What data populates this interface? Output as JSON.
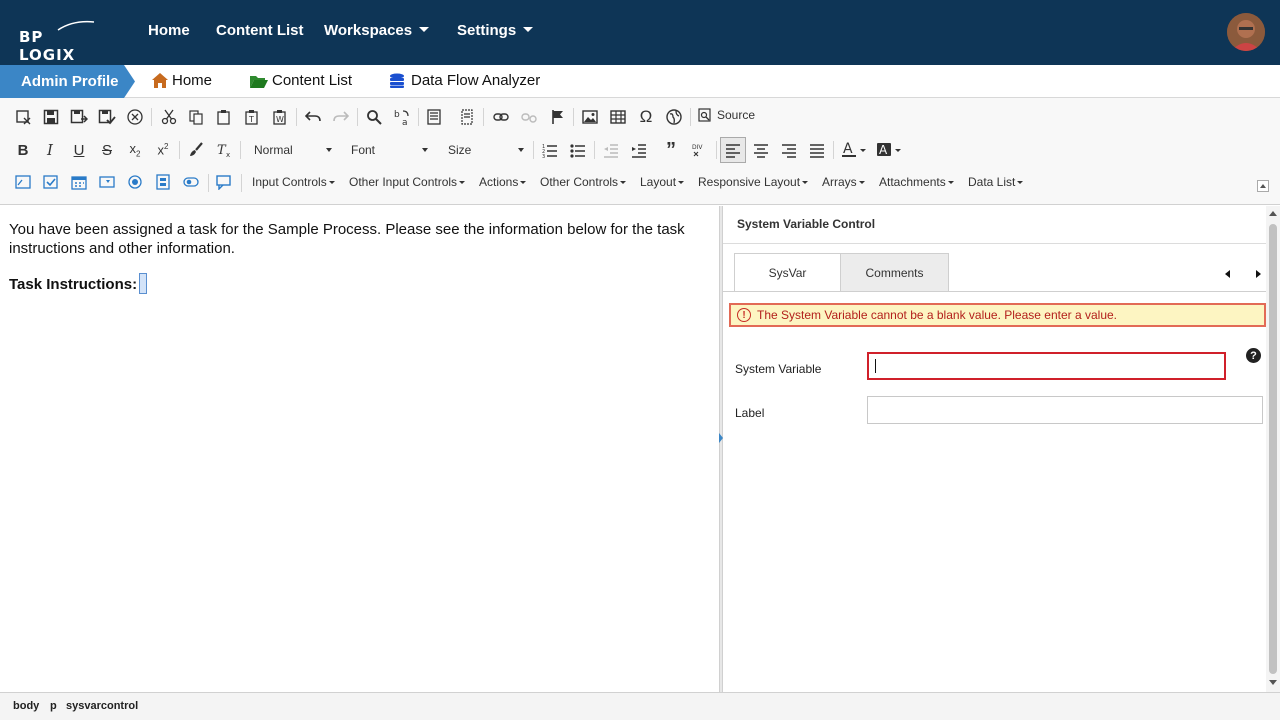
{
  "brand": {
    "logo_text": "BP LOGIX"
  },
  "topnav": {
    "home": "Home",
    "content_list": "Content List",
    "workspaces": "Workspaces",
    "settings": "Settings"
  },
  "breadcrumb": {
    "active": "Admin Profile",
    "home": "Home",
    "content_list": "Content List",
    "data_flow": "Data Flow Analyzer"
  },
  "toolbar": {
    "source_label": "Source",
    "format_combo": "Normal",
    "font_combo": "Font",
    "size_combo": "Size",
    "menus": [
      "Input Controls",
      "Other Input Controls",
      "Actions",
      "Other Controls",
      "Layout",
      "Responsive Layout",
      "Arrays",
      "Attachments",
      "Data List"
    ]
  },
  "editor": {
    "paragraph1": "You have been assigned a task for the Sample Process. Please see the information below for the task instructions and other information.",
    "task_label": "Task Instructions:"
  },
  "panel": {
    "title": "System Variable Control",
    "tabs": [
      "SysVar",
      "Comments"
    ],
    "error_message": "The System Variable cannot be a blank value. Please enter a value.",
    "fields": {
      "system_variable_label": "System Variable",
      "system_variable_value": "",
      "label_label": "Label",
      "label_value": ""
    },
    "help": "?"
  },
  "statusbar": {
    "path": [
      "body",
      "p",
      "sysvarcontrol"
    ]
  },
  "colors": {
    "navbar": "#0e3556",
    "breadcrumb_active": "#3b86c6",
    "error_border": "#d0202a",
    "error_bg": "#fdf5c2"
  }
}
